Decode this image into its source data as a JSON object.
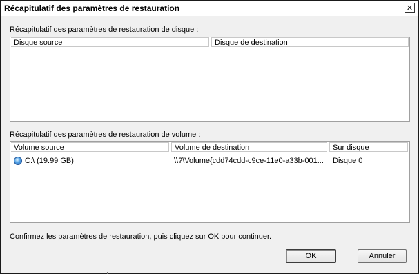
{
  "window": {
    "title": "Récapitulatif des paramètres de restauration"
  },
  "disk_section": {
    "label": "Récapitulatif des paramètres de restauration de disque :",
    "columns": [
      "Disque source",
      "Disque de destination"
    ],
    "rows": []
  },
  "volume_section": {
    "label": "Récapitulatif des paramètres de restauration de volume :",
    "columns": [
      "Volume source",
      "Volume de destination",
      "Sur disque"
    ],
    "rows": [
      {
        "icon": "disk-volume-icon",
        "source": "C:\\ (19.99 GB)",
        "destination": "\\\\?\\Volume{cdd74cdd-c9ce-11e0-a33b-001...",
        "disk": "Disque 0"
      }
    ]
  },
  "footer": {
    "message": "Confirmez les paramètres de restauration, puis cliquez sur OK pour continuer.",
    "ok_label": "OK",
    "cancel_label": "Annuler"
  }
}
